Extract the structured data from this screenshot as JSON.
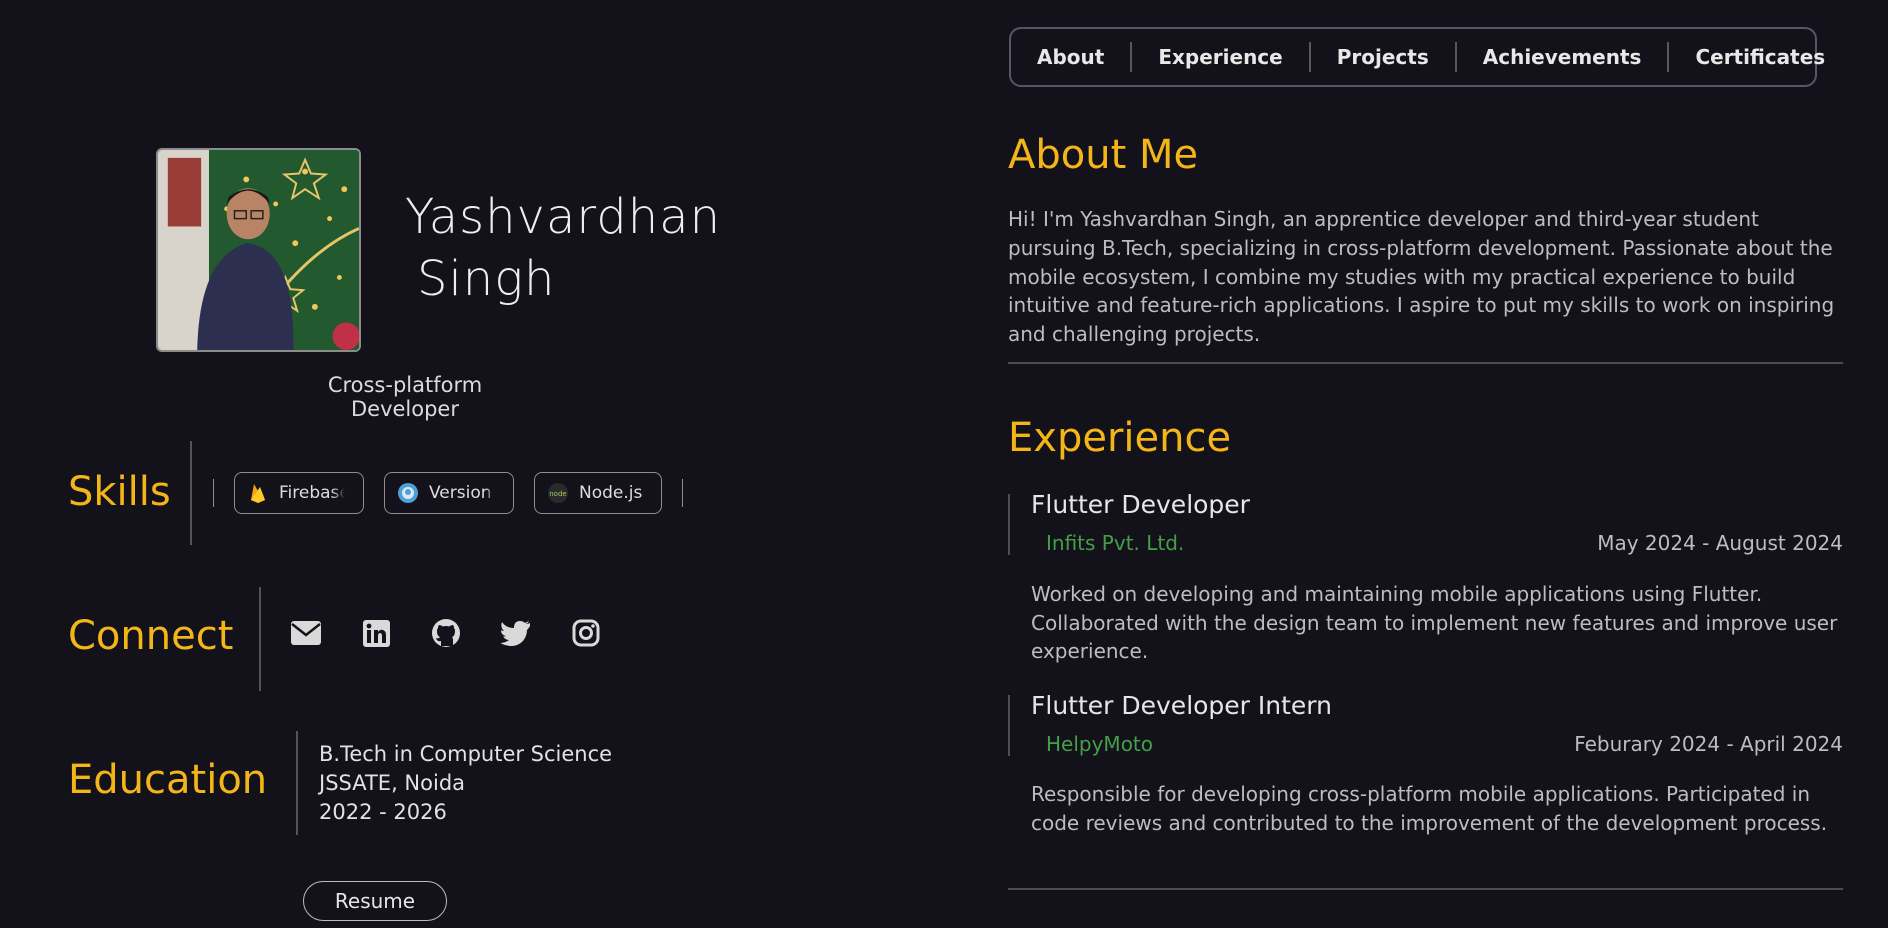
{
  "profile": {
    "first_name": "Yashvardhan",
    "last_name": "Singh",
    "role": "Cross-platform Developer"
  },
  "skills": {
    "label": "Skills",
    "items": [
      {
        "label": "Firebase",
        "icon": "firebase-icon"
      },
      {
        "label": "Version",
        "icon": "github-octocat-icon"
      },
      {
        "label": "Node.js",
        "icon": "nodejs-icon"
      }
    ]
  },
  "connect": {
    "label": "Connect",
    "icons": [
      "envelope-icon",
      "linkedin-icon",
      "github-icon",
      "twitter-icon",
      "instagram-icon"
    ]
  },
  "education": {
    "label": "Education",
    "degree": "B.Tech in Computer Science",
    "institution": "JSSATE, Noida",
    "years": "2022 - 2026"
  },
  "resume_label": "Resume",
  "nav": {
    "items": [
      "About",
      "Experience",
      "Projects",
      "Achievements",
      "Certificates"
    ]
  },
  "about": {
    "heading": "About Me",
    "text": "Hi! I'm Yashvardhan Singh, an apprentice developer and third-year student pursuing B.Tech, specializing in cross-platform development. Passionate about the mobile ecosystem, I combine my studies with my practical experience to build intuitive and feature-rich applications. I aspire to put my skills to work on inspiring and challenging projects."
  },
  "experience": {
    "heading": "Experience",
    "jobs": [
      {
        "title": "Flutter Developer",
        "company": "Infits Pvt. Ltd.",
        "dates": "May 2024 - August 2024",
        "description": "Worked on developing and maintaining mobile applications using Flutter. Collaborated with the design team to implement new features and improve user experience."
      },
      {
        "title": "Flutter Developer Intern",
        "company": "HelpyMoto",
        "dates": "Feburary 2024 - April 2024",
        "description": "Responsible for developing cross-platform mobile applications. Participated in code reviews and contributed to the improvement of the development process."
      }
    ]
  },
  "colors": {
    "background": "#13111a",
    "accent": "#f3b518",
    "company": "#43a047"
  }
}
